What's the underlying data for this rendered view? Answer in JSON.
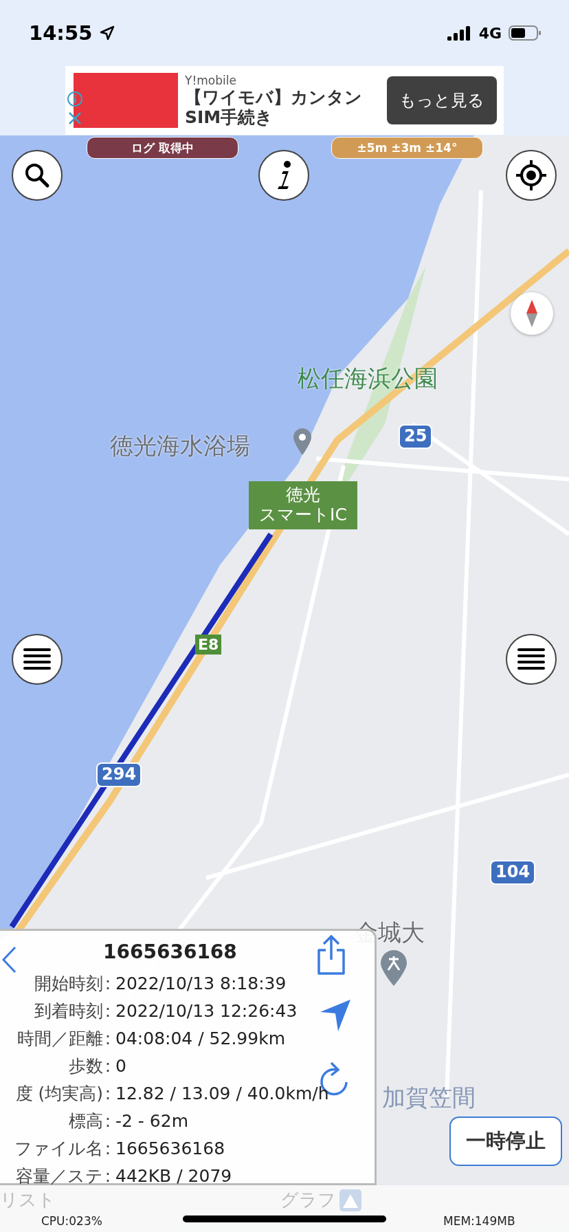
{
  "status_bar": {
    "time": "14:55",
    "network": "4G"
  },
  "ad": {
    "advertiser": "Y!mobile",
    "headline_lines": [
      "【ワイモバ】カンタン",
      "SIM手続き"
    ],
    "button": "もっと見る"
  },
  "badges": [
    {
      "kind": "logging",
      "text": "ログ 取得中"
    },
    {
      "kind": "accuracy",
      "text": "±5m ±3m ±14°"
    }
  ],
  "map_labels": [
    {
      "kind": "park",
      "text": "松任海浜公園"
    },
    {
      "kind": "place",
      "text": "徳光海水浴場"
    },
    {
      "kind": "route",
      "text": "25"
    },
    {
      "kind": "ic",
      "lines": [
        "徳光",
        "スマートIC"
      ]
    },
    {
      "kind": "highway",
      "text": "E8"
    },
    {
      "kind": "route",
      "text": "294"
    },
    {
      "kind": "route",
      "text": "104"
    },
    {
      "kind": "place",
      "text": "金城大"
    },
    {
      "kind": "faded",
      "text": "加賀笠間"
    }
  ],
  "track_panel": {
    "title": "1665636168",
    "rows": [
      {
        "label": "開始時刻",
        "sep": ":",
        "value": "2022/10/13 8:18:39"
      },
      {
        "label": "到着時刻",
        "sep": ":",
        "value": "2022/10/13 12:26:43"
      },
      {
        "label": "時間／距離",
        "sep": ":",
        "value": "04:08:04 / 52.99km"
      },
      {
        "label": "歩数",
        "sep": ":",
        "value": "0"
      },
      {
        "label": "度 (均実高)",
        "sep": ":",
        "value": "12.82 / 13.09 / 40.0km/h"
      },
      {
        "label": "標高",
        "sep": ":",
        "value": "-2 - 62m"
      },
      {
        "label": "ファイル名",
        "sep": ":",
        "value": "1665636168"
      },
      {
        "label": "容量／ステ",
        "sep": ":",
        "value": "442KB / 2079"
      }
    ]
  },
  "pause_button": "一時停止",
  "bottom_bar": {
    "list_tab": "リスト",
    "graph_tab": "グラフ",
    "cpu": "CPU:023%",
    "mem": "MEM:149MB"
  }
}
